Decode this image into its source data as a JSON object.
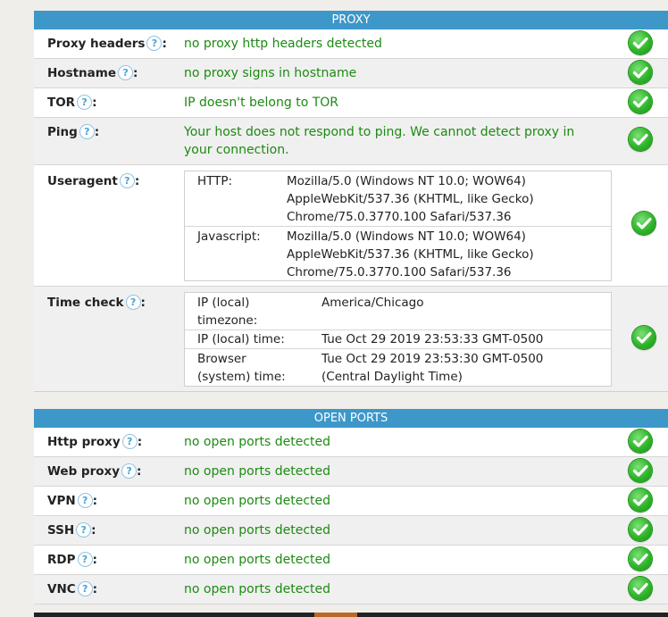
{
  "proxy": {
    "title": "PROXY",
    "rows": [
      {
        "label": "Proxy headers",
        "value": "no proxy http headers detected"
      },
      {
        "label": "Hostname",
        "value": "no proxy signs in hostname"
      },
      {
        "label": "TOR",
        "value": "IP doesn't belong to TOR"
      },
      {
        "label": "Ping",
        "value": "Your host does not respond to ping. We cannot detect proxy in your connection."
      }
    ],
    "useragent": {
      "label": "Useragent",
      "http_key": "HTTP:",
      "http_value": "Mozilla/5.0 (Windows NT 10.0; WOW64) AppleWebKit/537.36 (KHTML, like Gecko) Chrome/75.0.3770.100 Safari/537.36",
      "js_key": "Javascript:",
      "js_value": "Mozilla/5.0 (Windows NT 10.0; WOW64) AppleWebKit/537.36 (KHTML, like Gecko) Chrome/75.0.3770.100 Safari/537.36"
    },
    "timecheck": {
      "label": "Time check",
      "tz_key": "IP (local) timezone:",
      "tz_value": "America/Chicago",
      "iptime_key": "IP (local) time:",
      "iptime_value": "Tue Oct 29 2019 23:53:33 GMT-0500",
      "browser_key": "Browser (system) time:",
      "browser_value": "Tue Oct 29 2019 23:53:30 GMT-0500 (Central Daylight Time)"
    }
  },
  "ports": {
    "title": "OPEN PORTS",
    "rows": [
      {
        "label": "Http proxy",
        "value": "no open ports detected"
      },
      {
        "label": "Web proxy",
        "value": "no open ports detected"
      },
      {
        "label": "VPN",
        "value": "no open ports detected"
      },
      {
        "label": "SSH",
        "value": "no open ports detected"
      },
      {
        "label": "RDP",
        "value": "no open ports detected"
      },
      {
        "label": "VNC",
        "value": "no open ports detected"
      }
    ]
  },
  "help_glyph": "?",
  "colon": ":",
  "icons": {
    "check": "check-circle-icon",
    "help": "help-circle-icon"
  },
  "colors": {
    "header_bg": "#3d97c9",
    "ok_text": "#1d8a12",
    "check_green": "#2fb52a",
    "help_blue": "#4aa3d6"
  }
}
